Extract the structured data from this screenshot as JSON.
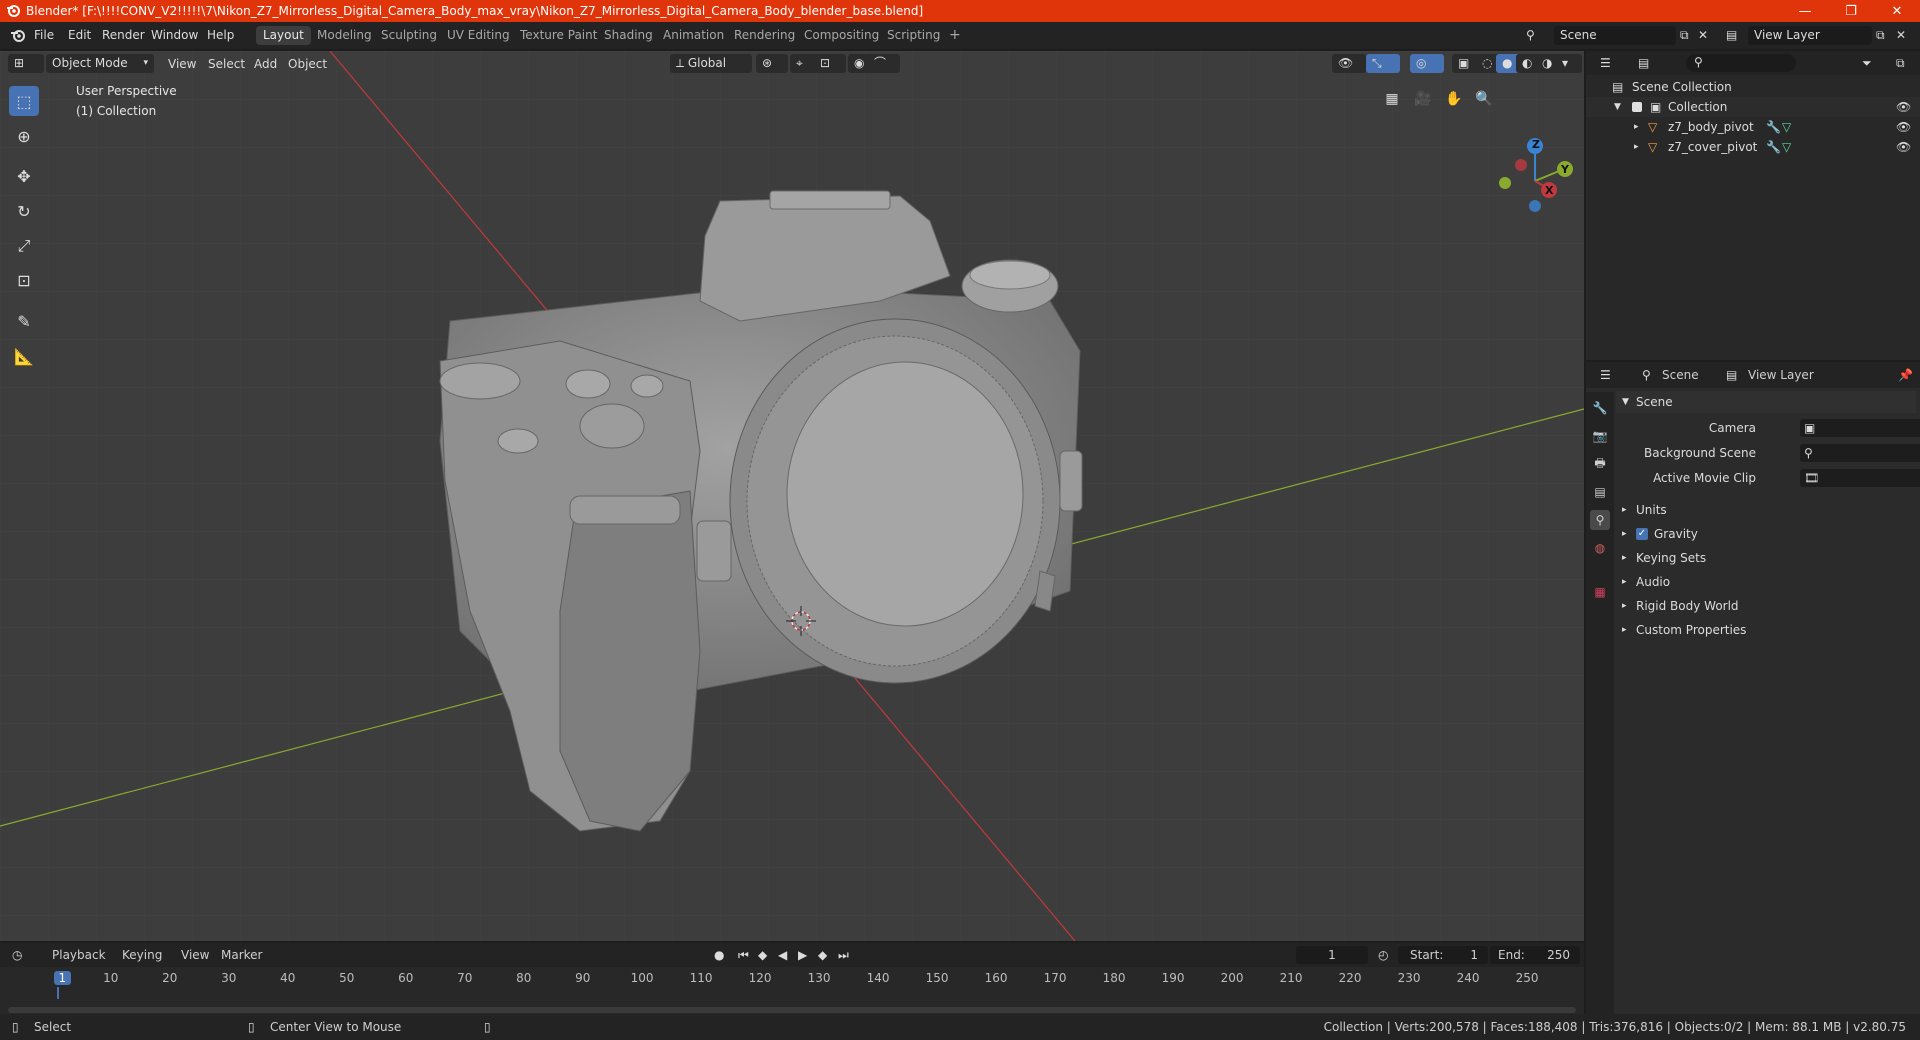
{
  "window": {
    "title": "Blender* [F:\\!!!!CONV_V2!!!!!\\7\\Nikon_Z7_Mirrorless_Digital_Camera_Body_max_vray\\Nikon_Z7_Mirrorless_Digital_Camera_Body_blender_base.blend]",
    "controls": {
      "minimize": "—",
      "maximize": "❐",
      "close": "✕"
    }
  },
  "menu": [
    "File",
    "Edit",
    "Render",
    "Window",
    "Help"
  ],
  "workspaces": [
    "Layout",
    "Modeling",
    "Sculpting",
    "UV Editing",
    "Texture Paint",
    "Shading",
    "Animation",
    "Rendering",
    "Compositing",
    "Scripting"
  ],
  "add_workspace": "+",
  "scene_field": "Scene",
  "view_layer_field": "View Layer",
  "viewport": {
    "mode": "Object Mode",
    "menus": [
      "View",
      "Select",
      "Add",
      "Object"
    ],
    "transform_orientation": "Global",
    "perspective_label": "User Perspective",
    "collection_label": "(1) Collection",
    "gizmo": {
      "z": "Z",
      "y": "Y",
      "x": "X"
    }
  },
  "outliner": {
    "root": "Scene Collection",
    "collection": "Collection",
    "objects": [
      "z7_body_pivot",
      "z7_cover_pivot"
    ]
  },
  "properties": {
    "tab_scene": "Scene",
    "tab_view_layer": "View Layer",
    "panel_title": "Scene",
    "fields": [
      "Camera",
      "Background Scene",
      "Active Movie Clip"
    ],
    "sections": [
      "Units",
      "Gravity",
      "Keying Sets",
      "Audio",
      "Rigid Body World",
      "Custom Properties"
    ],
    "gravity_checked": true
  },
  "timeline": {
    "menus": [
      "Playback",
      "Keying",
      "View",
      "Marker"
    ],
    "current_frame": "1",
    "start_label": "Start:",
    "start": "1",
    "end_label": "End:",
    "end": "250",
    "ruler": [
      "1",
      "10",
      "20",
      "30",
      "40",
      "50",
      "60",
      "70",
      "80",
      "90",
      "100",
      "110",
      "120",
      "130",
      "140",
      "150",
      "160",
      "170",
      "180",
      "190",
      "200",
      "210",
      "220",
      "230",
      "240",
      "250"
    ]
  },
  "status": {
    "left_hint": "Select",
    "middle_hint": "Center View to Mouse",
    "stats": "Collection | Verts:200,578 | Faces:188,408 | Tris:376,816 | Objects:0/2 | Mem: 88.1 MB | v2.80.75"
  },
  "colors": {
    "titlebar": "#e0350b",
    "accent": "#4772b3",
    "axis_x": "#c0393e",
    "axis_y": "#8aaa2e",
    "model": "#8e8e8e"
  }
}
